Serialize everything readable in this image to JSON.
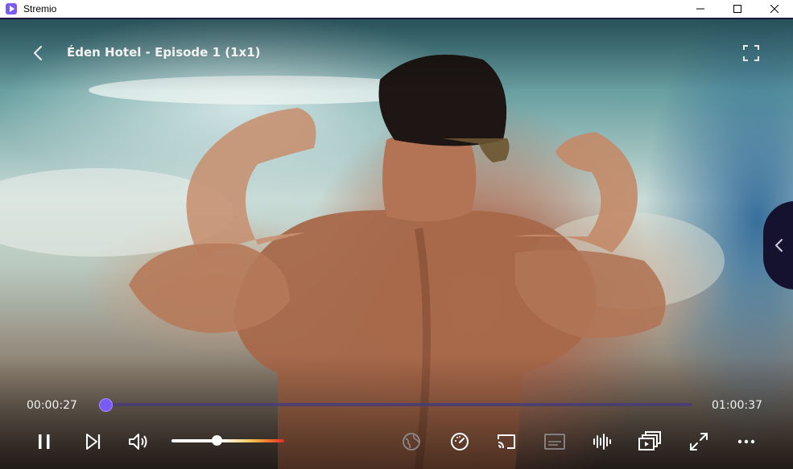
{
  "window": {
    "app_title": "Stremio",
    "icons": {
      "logo": "stremio-logo-icon",
      "minimize": "minimize-icon",
      "maximize": "maximize-icon",
      "close": "close-icon"
    }
  },
  "player": {
    "title": "Éden Hotel - Episode 1 (1x1)",
    "time_current": "00:00:27",
    "time_total": "01:00:37",
    "progress_fraction": 0.007,
    "volume_fraction": 0.4,
    "state": "playing",
    "icons": {
      "back": "chevron-left-icon",
      "fullscreen_top": "fullscreen-icon",
      "side_panel": "chevron-left-icon",
      "pause": "pause-icon",
      "next": "next-episode-icon",
      "volume": "volume-icon",
      "translate": "globe-icon",
      "speed": "speedometer-icon",
      "cast": "cast-icon",
      "subtitles": "subtitles-icon",
      "audio": "audio-waveform-icon",
      "episodes": "episodes-list-icon",
      "fullscreen": "expand-icon",
      "more": "more-icon"
    }
  },
  "colors": {
    "accent": "#7b5bf5",
    "seek_track": "#463c78",
    "panel": "#14122e",
    "titlebar_bg": "#ffffff"
  }
}
